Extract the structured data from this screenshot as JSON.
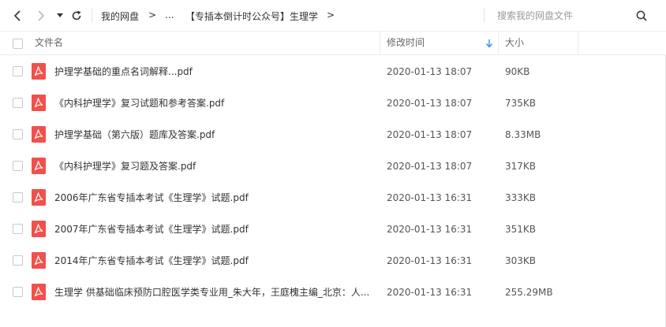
{
  "nav": {
    "back_icon": "chevron-left-icon",
    "forward_icon": "chevron-right-icon",
    "dropdown_icon": "caret-down-icon",
    "refresh_icon": "refresh-icon"
  },
  "breadcrumb": {
    "root": "我的网盘",
    "arrow": ">",
    "ellipsis": "...",
    "folder": "【专插本倒计时公众号】生理学"
  },
  "search": {
    "placeholder": "搜索我的网盘文件",
    "icon": "search-icon"
  },
  "columns": {
    "name": "文件名",
    "modified": "修改时间",
    "size": "大小",
    "sort_icon": "sort-down-arrow-icon"
  },
  "files": [
    {
      "name": "护理学基础的重点名词解释...pdf",
      "modified": "2020-01-13 18:07",
      "size": "90KB"
    },
    {
      "name": "《内科护理学》复习试题和参考答案.pdf",
      "modified": "2020-01-13 18:07",
      "size": "735KB"
    },
    {
      "name": "护理学基础（第六版）题库及答案.pdf",
      "modified": "2020-01-13 18:07",
      "size": "8.33MB"
    },
    {
      "name": "《内科护理学》复习题及答案.pdf",
      "modified": "2020-01-13 18:07",
      "size": "317KB"
    },
    {
      "name": "2006年广东省专插本考试《生理学》试题.pdf",
      "modified": "2020-01-13 16:31",
      "size": "333KB"
    },
    {
      "name": "2007年广东省专插本考试《生理学》试题.pdf",
      "modified": "2020-01-13 16:31",
      "size": "351KB"
    },
    {
      "name": "2014年广东省专插本考试《生理学》试题.pdf",
      "modified": "2020-01-13 16:31",
      "size": "303KB"
    },
    {
      "name": "生理学 供基础临床预防口腔医学类专业用_朱大年，王庭槐主编_北京：人...",
      "modified": "2020-01-13 16:31",
      "size": "255.29MB"
    }
  ],
  "colors": {
    "pdf_icon": "#f2504b",
    "sort_arrow": "#3b8cff",
    "border": "#ececec"
  }
}
